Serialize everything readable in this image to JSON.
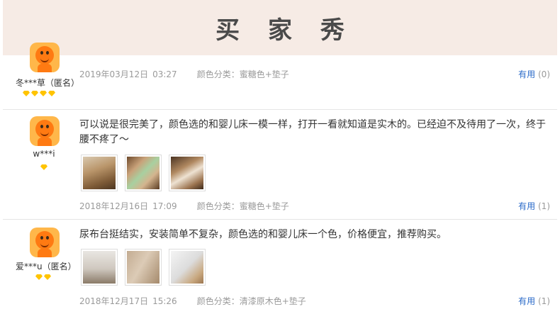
{
  "header": {
    "title": "买 家 秀"
  },
  "reviews": [
    {
      "user": "冬***草（匿名）",
      "level_gems": 4,
      "content": "",
      "date": "2019年03月12日",
      "time": "03:27",
      "variant": "颜色分类：蜜糖色+垫子",
      "useful_label": "有用",
      "useful_count": "(0)"
    },
    {
      "user": "w***i",
      "level_gems": 1,
      "content": "可以说是很完美了，颜色选的和婴儿床一模一样，打开一看就知道是实木的。已经迫不及待用了一次，终于腰不疼了～",
      "photos": [
        "photo-1",
        "photo-2",
        "photo-3"
      ],
      "date": "2018年12月16日",
      "time": "17:09",
      "variant": "颜色分类：蜜糖色+垫子",
      "useful_label": "有用",
      "useful_count": "(1)"
    },
    {
      "user": "爱***u（匿名）",
      "level_gems": 2,
      "content": "尿布台挺结实，安装简单不复杂，颜色选的和婴儿床一个色，价格便宜，推荐购买。",
      "photos": [
        "photo-1",
        "photo-2",
        "photo-3"
      ],
      "date": "2018年12月17日",
      "time": "15:26",
      "variant": "颜色分类：清漆原木色+垫子",
      "useful_label": "有用",
      "useful_count": "(1)"
    }
  ],
  "colors": {
    "banner_bg": "#f6ebe5",
    "link_blue": "#2a6ac8",
    "gem_gold": "#ffc400",
    "avatar_orange": "#ff7a12"
  }
}
